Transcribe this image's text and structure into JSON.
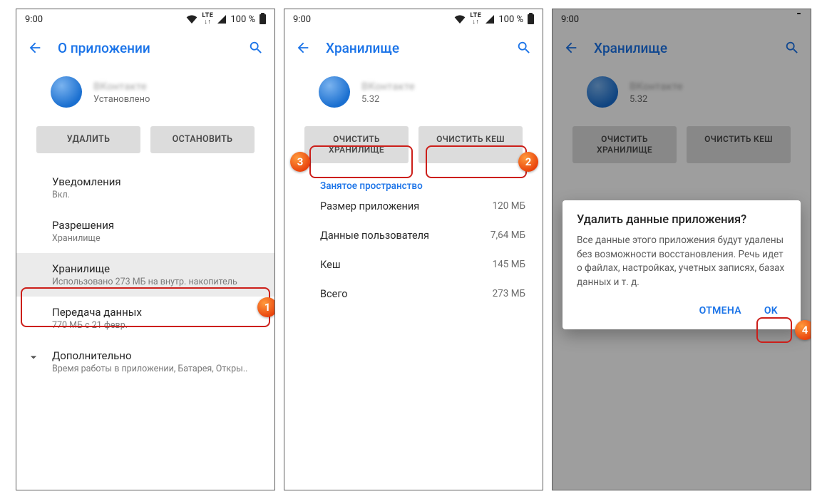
{
  "status": {
    "time": "9:00",
    "net": "LTE",
    "battery": "100 %"
  },
  "s1": {
    "title": "О приложении",
    "app_name": "ВКонтакте",
    "app_sub": "Установлено",
    "btn_uninstall": "УДАЛИТЬ",
    "btn_stop": "ОСТАНОВИТЬ",
    "notif_label": "Уведомления",
    "notif_sub": "Вкл.",
    "perm_label": "Разрешения",
    "perm_sub": "Хранилище",
    "storage_label": "Хранилище",
    "storage_sub": "Использовано 273 МБ на внутр. накопитель",
    "data_label": "Передача данных",
    "data_sub": "770 МБ с 21 февр.",
    "adv_label": "Дополнительно",
    "adv_sub": "Время работы в приложении, Батарея, Откры.."
  },
  "s2": {
    "title": "Хранилище",
    "app_name": "ВКонтакте",
    "app_sub": "5.32",
    "btn_clear_storage": "ОЧИСТИТЬ ХРАНИЛИЩЕ",
    "btn_clear_cache": "ОЧИСТИТЬ КЕШ",
    "section": "Занятое пространство",
    "rows": [
      {
        "label": "Размер приложения",
        "value": "120 МБ"
      },
      {
        "label": "Данные пользователя",
        "value": "7,64 МБ"
      },
      {
        "label": "Кеш",
        "value": "145 МБ"
      },
      {
        "label": "Всего",
        "value": "273 МБ"
      }
    ]
  },
  "s3": {
    "title": "Хранилище",
    "app_name": "ВКонтакте",
    "app_sub": "5.32",
    "btn_clear_storage": "ОЧИСТИТЬ ХРАНИЛИЩЕ",
    "btn_clear_cache": "ОЧИСТИТЬ КЕШ",
    "dialog_title": "Удалить данные приложения?",
    "dialog_body": "Все данные этого приложения будут удалены без возможности восстановления. Речь идет о файлах, настройках, учетных записях, базах данных и т. д.",
    "cancel": "ОТМЕНА",
    "ok": "OK"
  },
  "callouts": {
    "c1": "1",
    "c2": "2",
    "c3": "3",
    "c4": "4"
  }
}
